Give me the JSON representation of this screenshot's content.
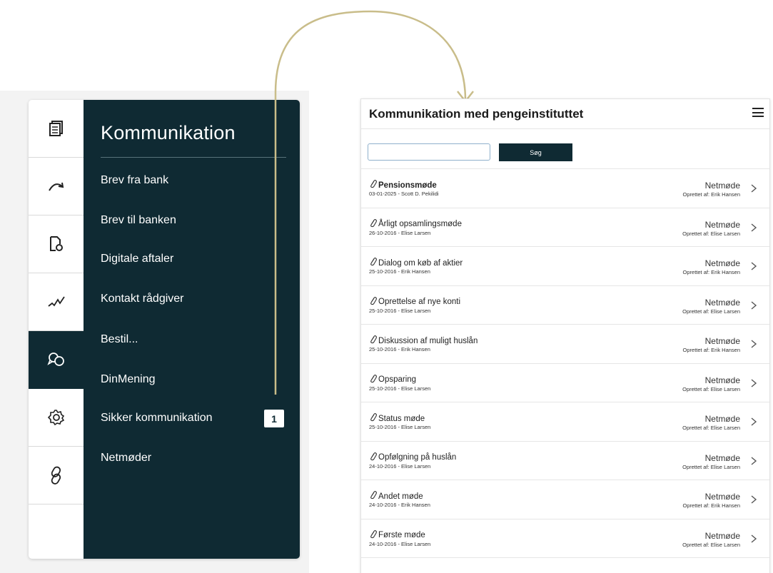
{
  "sidebar": {
    "rail": [
      {
        "icon": "documents-icon"
      },
      {
        "icon": "transfer-arrow-icon"
      },
      {
        "icon": "file-settings-icon"
      },
      {
        "icon": "chart-line-icon"
      },
      {
        "icon": "chat-bubbles-icon",
        "active": true
      },
      {
        "icon": "gear-icon"
      },
      {
        "icon": "link-icon"
      }
    ],
    "title": "Kommunikation",
    "items": [
      {
        "label": "Brev fra bank"
      },
      {
        "label": "Brev til banken"
      },
      {
        "label": "Digitale aftaler"
      },
      {
        "label": "Kontakt rådgiver"
      },
      {
        "label": "Bestil..."
      },
      {
        "label": "DinMening"
      },
      {
        "label": "Sikker kommunikation",
        "badge": "1"
      },
      {
        "label": "Netmøder"
      }
    ]
  },
  "panel": {
    "title": "Kommunikation med pengeinstituttet",
    "search_placeholder": "",
    "search_button": "Søg",
    "meetings": [
      {
        "title": "Pensionsmøde",
        "bold": true,
        "sub": "03-01-2025 - Scott D. Pekilidi",
        "type": "Netmøde",
        "created": "Oprettet af: Erik Hansen"
      },
      {
        "title": "Årligt opsamlingsmøde",
        "sub": "26-10-2016 - Elise Larsen",
        "type": "Netmøde",
        "created": "Oprettet af: Elise Larsen"
      },
      {
        "title": "Dialog om køb af aktier",
        "sub": "25-10-2016 - Erik Hansen",
        "type": "Netmøde",
        "created": "Oprettet af: Erik Hansen"
      },
      {
        "title": "Oprettelse af nye konti",
        "sub": "25-10-2016 - Elise Larsen",
        "type": "Netmøde",
        "created": "Oprettet af: Elise Larsen"
      },
      {
        "title": "Diskussion af muligt huslån",
        "sub": "25-10-2016 - Erik Hansen",
        "type": "Netmøde",
        "created": "Oprettet af: Erik Hansen"
      },
      {
        "title": "Opsparing",
        "sub": "25-10-2016 - Elise Larsen",
        "type": "Netmøde",
        "created": "Oprettet af: Elise Larsen"
      },
      {
        "title": "Status møde",
        "sub": "25-10-2016 - Elise Larsen",
        "type": "Netmøde",
        "created": "Oprettet af: Elise Larsen"
      },
      {
        "title": "Opfølgning på huslån",
        "sub": "24-10-2016 - Elise Larsen",
        "type": "Netmøde",
        "created": "Oprettet af: Elise Larsen"
      },
      {
        "title": "Andet møde",
        "sub": "24-10-2016 - Erik Hansen",
        "type": "Netmøde",
        "created": "Oprettet af: Erik Hansen"
      },
      {
        "title": "Første møde",
        "sub": "24-10-2016 - Elise Larsen",
        "type": "Netmøde",
        "created": "Oprettet af: Elise Larsen"
      }
    ]
  },
  "colors": {
    "dark_teal": "#0f2a33",
    "connector": "#c9bd8a"
  }
}
